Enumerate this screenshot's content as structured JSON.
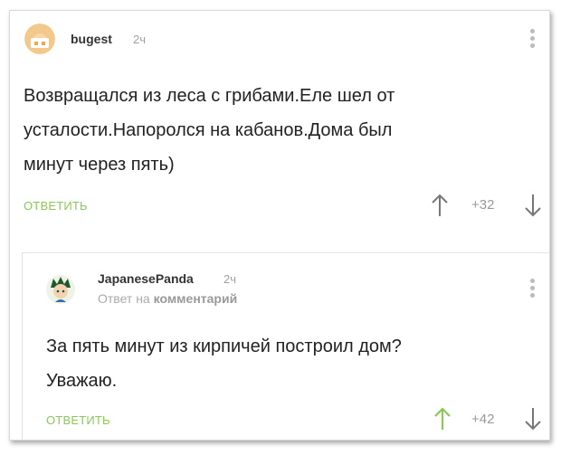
{
  "comment1": {
    "username": "bugest",
    "time": "2ч",
    "lines": [
      "Возвращался из леса с грибами.Еле шел от",
      "усталости.Напоролся на кабанов.Дома был",
      "минут через пять)"
    ],
    "reply_label": "ОТВЕТИТЬ",
    "score": "+32"
  },
  "comment2": {
    "username": "JapanesePanda",
    "time": "2ч",
    "reply_to_prefix": "Ответ на",
    "reply_to_target": "комментарий",
    "lines": [
      "За пять минут из кирпичей построил дом?",
      "Уважаю."
    ],
    "reply_label": "ОТВЕТИТЬ",
    "score": "+42"
  },
  "colors": {
    "accent_green": "#8ac858",
    "upvoted_green": "#8ac858",
    "text": "#222222",
    "muted": "#a0a0a0"
  },
  "icons": {
    "upvote": "arrow-up-icon",
    "downvote": "arrow-down-icon",
    "more": "more-vertical-icon"
  }
}
